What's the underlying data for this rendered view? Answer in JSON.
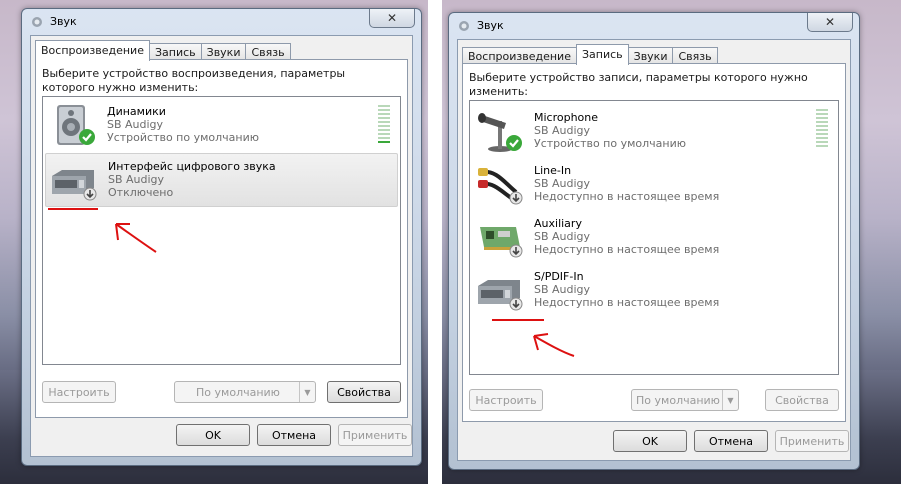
{
  "colors": {
    "accent": "#3aa83a",
    "annotation": "#dd1111",
    "disabled": "#9a9a9a"
  },
  "windows": [
    {
      "title": "Звук",
      "close_glyph": "✕",
      "tabs": [
        {
          "label": "Воспроизведение",
          "active": true
        },
        {
          "label": "Запись",
          "active": false
        },
        {
          "label": "Звуки",
          "active": false
        },
        {
          "label": "Связь",
          "active": false
        }
      ],
      "prompt": "Выберите устройство воспроизведения, параметры которого нужно изменить:",
      "devices": [
        {
          "name": "Динамики",
          "sub1": "SB Audigy",
          "sub2": "Устройство по умолчанию",
          "icon": "speaker-icon",
          "status": "default-check-icon",
          "meter_level": 1,
          "selected": false
        },
        {
          "name": "Интерфейс цифрового звука",
          "sub1": "SB Audigy",
          "sub2": "Отключено",
          "icon": "digital-audio-icon",
          "status": "disabled-arrow-icon",
          "selected": true
        }
      ],
      "buttons": {
        "configure": "Настроить",
        "set_default": "По умолчанию",
        "properties": "Свойства",
        "ok": "OK",
        "cancel": "Отмена",
        "apply": "Применить"
      }
    },
    {
      "title": "Звук",
      "close_glyph": "✕",
      "tabs": [
        {
          "label": "Воспроизведение",
          "active": false
        },
        {
          "label": "Запись",
          "active": true
        },
        {
          "label": "Звуки",
          "active": false
        },
        {
          "label": "Связь",
          "active": false
        }
      ],
      "prompt": "Выберите устройство записи, параметры которого нужно изменить:",
      "devices": [
        {
          "name": "Microphone",
          "sub1": "SB Audigy",
          "sub2": "Устройство по умолчанию",
          "icon": "microphone-icon",
          "status": "default-check-icon",
          "meter_level": 0,
          "selected": false
        },
        {
          "name": "Line-In",
          "sub1": "SB Audigy",
          "sub2": "Недоступно в настоящее время",
          "icon": "rca-cable-icon",
          "status": "disabled-arrow-icon",
          "selected": false
        },
        {
          "name": "Auxiliary",
          "sub1": "SB Audigy",
          "sub2": "Недоступно в настоящее время",
          "icon": "sound-card-icon",
          "status": "disabled-arrow-icon",
          "selected": false
        },
        {
          "name": "S/PDIF-In",
          "sub1": "SB Audigy",
          "sub2": "Недоступно в настоящее время",
          "icon": "digital-audio-icon",
          "status": "disabled-arrow-icon",
          "selected": false
        }
      ],
      "buttons": {
        "configure": "Настроить",
        "set_default": "По умолчанию",
        "properties": "Свойства",
        "ok": "OK",
        "cancel": "Отмена",
        "apply": "Применить"
      }
    }
  ]
}
